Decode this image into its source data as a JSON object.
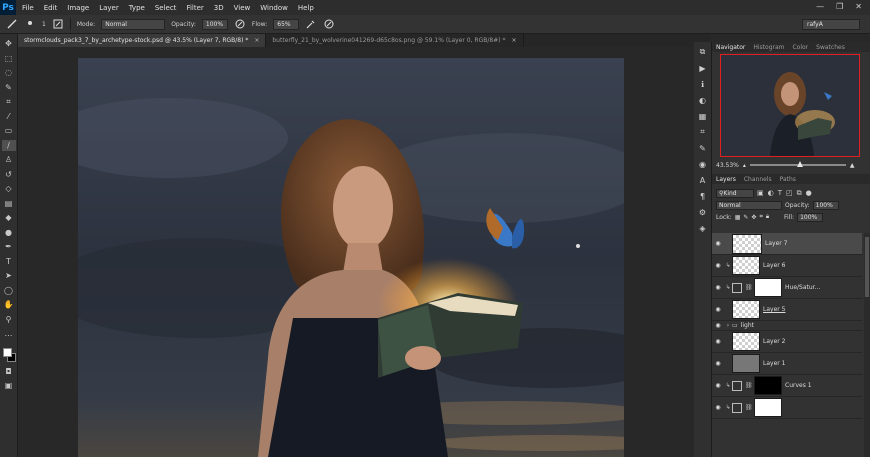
{
  "app": {
    "logo": "Ps"
  },
  "menu": [
    "File",
    "Edit",
    "Image",
    "Layer",
    "Type",
    "Select",
    "Filter",
    "3D",
    "View",
    "Window",
    "Help"
  ],
  "window_controls": [
    "—",
    "❐",
    "✕"
  ],
  "options": {
    "brush_size": "1",
    "mode_label": "Mode:",
    "mode_value": "Normal",
    "opacity_label": "Opacity:",
    "opacity_value": "100%",
    "flow_label": "Flow:",
    "flow_value": "65%",
    "workspace": "rafyA"
  },
  "tabs": [
    {
      "label": "stormclouds_pack3_7_by_archetype-stock.psd @ 43.5% (Layer 7, RGB/8) *",
      "active": true
    },
    {
      "label": "butterfly_21_by_wolverine041269-d65c8os.png @ 59.1% (Layer 0, RGB/8#) *",
      "active": false
    }
  ],
  "tools": [
    "move",
    "marquee",
    "lasso",
    "quick-select",
    "crop",
    "eyedropper",
    "heal",
    "brush",
    "stamp",
    "history-brush",
    "eraser",
    "gradient",
    "blur",
    "dodge",
    "pen",
    "type",
    "path-select",
    "shape",
    "hand",
    "zoom",
    "more"
  ],
  "panels": {
    "top_tabs": [
      "Navigator",
      "Histogram",
      "Color",
      "Swatches"
    ],
    "zoom_value": "43.53%",
    "zoom_level": 0.52,
    "layers_tabs": [
      "Layers",
      "Channels",
      "Paths"
    ],
    "kind_label": "Kind",
    "blend_mode": "Normal",
    "opacity_label": "Opacity:",
    "opacity_value": "100%",
    "lock_label": "Lock:",
    "fill_label": "Fill:",
    "fill_value": "100%"
  },
  "layers": [
    {
      "name": "Layer 7",
      "type": "pixel",
      "selected": true,
      "clipped": false
    },
    {
      "name": "Layer 6",
      "type": "pixel",
      "selected": false,
      "clipped": true
    },
    {
      "name": "Hue/Satur...",
      "type": "adjustment",
      "selected": false,
      "clipped": true
    },
    {
      "name": "Layer 5",
      "type": "pixel",
      "selected": false,
      "clipped": false
    },
    {
      "name": "light",
      "type": "group",
      "selected": false,
      "clipped": false
    },
    {
      "name": "Layer 2",
      "type": "pixel",
      "selected": false,
      "clipped": false
    },
    {
      "name": "Layer 1",
      "type": "pixel",
      "selected": false,
      "clipped": false
    },
    {
      "name": "Curves 1",
      "type": "adjustment",
      "selected": false,
      "clipped": true
    },
    {
      "name": "",
      "type": "adjustment",
      "selected": false,
      "clipped": true
    }
  ],
  "colors": {
    "accent_nav_box": "#e02020",
    "foreground": "#ffffff",
    "background": "#000000"
  }
}
